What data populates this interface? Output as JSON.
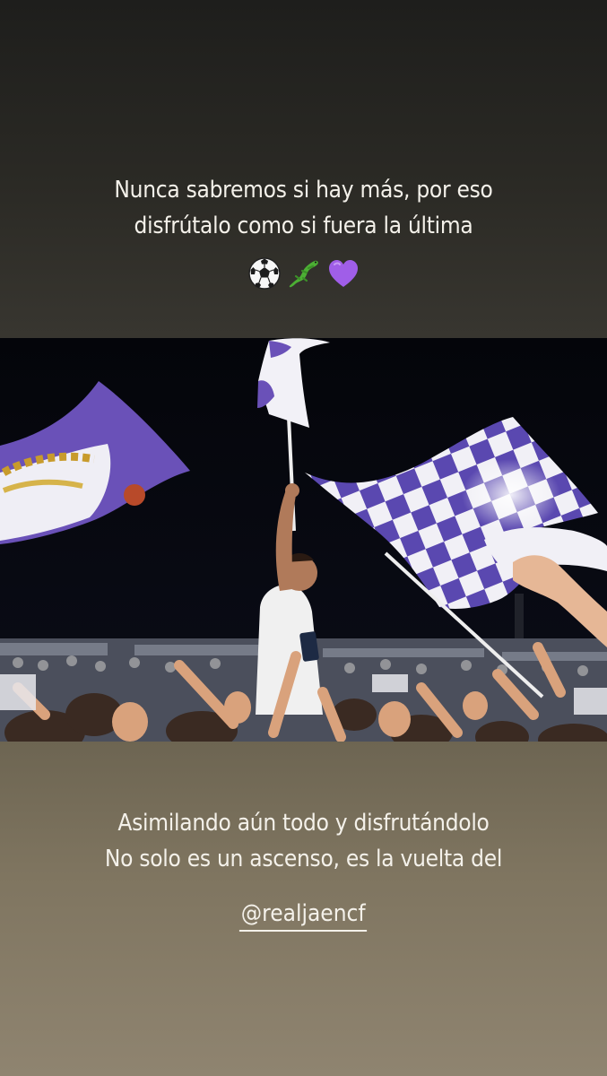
{
  "story": {
    "top_caption": {
      "line1": "Nunca sabremos si hay más, por eso",
      "line2": "disfrútalo como si fuera la última"
    },
    "emojis": [
      "soccer-ball-icon",
      "lizard-icon",
      "purple-heart-icon"
    ],
    "bottom_caption": {
      "line1": "Asimilando aún todo y disfrutándolo",
      "line2": "No solo es un ascenso, es la vuelta del"
    },
    "mention": "@realjaencf"
  },
  "colors": {
    "top_panel": "#2b2a25",
    "bottom_panel": "#7f7560",
    "text": "#f4f1ea",
    "flag_purple": "#5a48b0",
    "flag_white": "#f1f0f6"
  }
}
